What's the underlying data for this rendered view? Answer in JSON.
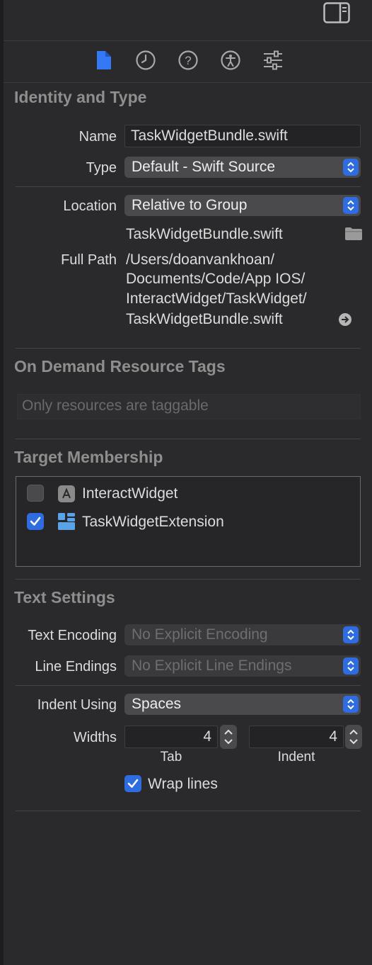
{
  "toolbar": {
    "icons": [
      "file-inspector-icon",
      "history-icon",
      "quick-help-icon",
      "accessibility-icon",
      "attributes-icon"
    ]
  },
  "identity": {
    "title": "Identity and Type",
    "name_label": "Name",
    "name_value": "TaskWidgetBundle.swift",
    "type_label": "Type",
    "type_value": "Default - Swift Source",
    "location_label": "Location",
    "location_value": "Relative to Group",
    "location_file": "TaskWidgetBundle.swift",
    "fullpath_label": "Full Path",
    "fullpath_lines": [
      "/Users/doanvankhoan/",
      "Documents/Code/App IOS/",
      "InteractWidget/TaskWidget/",
      "TaskWidgetBundle.swift"
    ]
  },
  "ondemand": {
    "title": "On Demand Resource Tags",
    "placeholder": "Only resources are taggable"
  },
  "membership": {
    "title": "Target Membership",
    "targets": [
      {
        "label": "InteractWidget",
        "checked": false
      },
      {
        "label": "TaskWidgetExtension",
        "checked": true
      }
    ]
  },
  "text_settings": {
    "title": "Text Settings",
    "encoding_label": "Text Encoding",
    "encoding_value": "No Explicit Encoding",
    "endings_label": "Line Endings",
    "endings_value": "No Explicit Line Endings",
    "indent_label": "Indent Using",
    "indent_value": "Spaces",
    "widths_label": "Widths",
    "tab_value": "4",
    "tab_caption": "Tab",
    "indent_width_value": "4",
    "indent_caption": "Indent",
    "wrap_label": "Wrap lines",
    "wrap_checked": true
  },
  "colors": {
    "accent": "#2f6ce0",
    "background": "#2a2a2c",
    "section_title": "#8e8e8e"
  }
}
